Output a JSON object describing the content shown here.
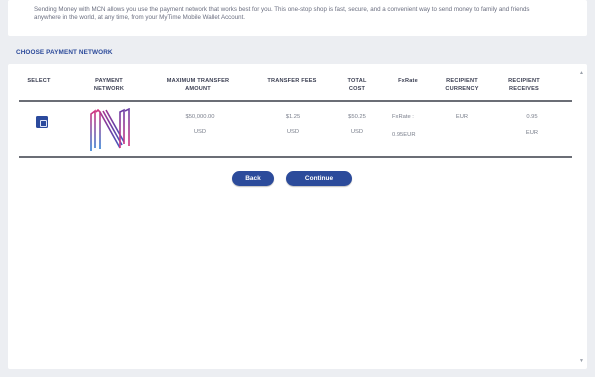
{
  "intro": {
    "text": "Sending Money with MCN allows you use the payment network that works best for you. This one-stop shop is fast, secure, and a convenient way to send money to family and friends anywhere in the world, at any time, from your MyTime Mobile Wallet Account."
  },
  "section_title": "CHOOSE PAYMENT NETWORK",
  "table": {
    "headers": {
      "select": "SELECT",
      "payment_network": "PAYMENT NETWORK",
      "max_transfer": "MAXIMUM TRANSFER AMOUNT",
      "transfer_fees": "TRANSFER FEES",
      "total_cost": "TOTAL COST",
      "fxrate": "FxRate",
      "recipient_currency": "RECIPIENT CURRENCY",
      "recipient_receives": "RECIPIENT RECEIVES"
    },
    "rows": [
      {
        "selected": true,
        "logo_icon": "network-n-logo-icon",
        "max_transfer_amount": "$50,000.00",
        "max_transfer_currency": "USD",
        "transfer_fee_amount": "$1.25",
        "transfer_fee_currency": "USD",
        "total_cost_amount": "$50.25",
        "total_cost_currency": "USD",
        "fxrate_label": "FxRate :",
        "fxrate_value": "0.95EUR",
        "recipient_currency": "EUR",
        "recipient_receives_amount": "0.95",
        "recipient_receives_currency": "EUR"
      }
    ]
  },
  "buttons": {
    "back": "Back",
    "continue": "Continue"
  },
  "colors": {
    "accent": "#2c4b9b",
    "logo_pink": "#d2337f",
    "logo_purple": "#6a3fa6",
    "logo_blue": "#2f7fd4"
  }
}
